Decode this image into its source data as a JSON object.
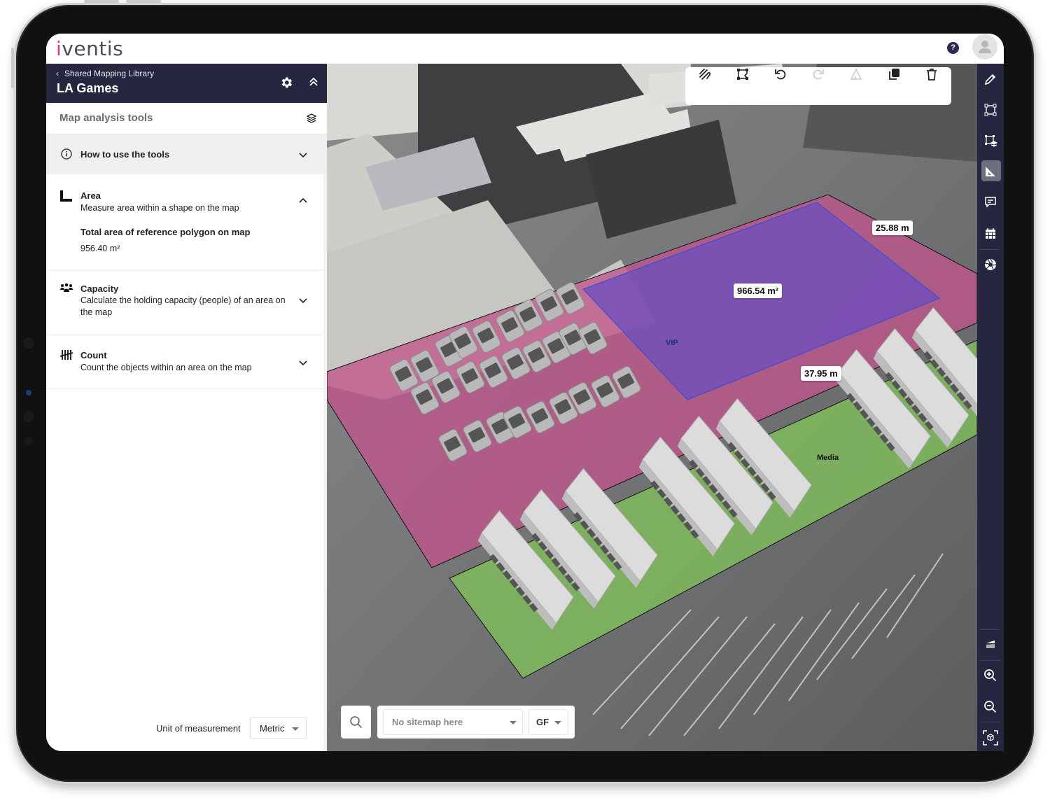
{
  "app": {
    "logo_first": "i",
    "logo_rest": "ventis",
    "help_label": "?",
    "brand_color": "#d63a8a",
    "navy": "#252740"
  },
  "panel": {
    "breadcrumb": "Shared Mapping Library",
    "project_title": "LA Games",
    "tools_title": "Map analysis tools",
    "how_to": "How to use the tools",
    "sections": [
      {
        "title": "Area",
        "description": "Measure area within a shape on the map",
        "expanded": true,
        "result_label": "Total area of reference polygon on map",
        "result_value": "956.40 m²"
      },
      {
        "title": "Capacity",
        "description": "Calculate the holding capacity (people) of an area on the map",
        "expanded": false
      },
      {
        "title": "Count",
        "description": "Count the objects within an area on the map",
        "expanded": false
      }
    ],
    "unit_label": "Unit of measurement",
    "unit_value": "Metric"
  },
  "map": {
    "measurements": {
      "area": "966.54 m²",
      "width": "25.88 m",
      "length": "37.95 m"
    },
    "zone_labels": {
      "vip": "VIP",
      "media": "Media"
    },
    "zone_colors": {
      "outer": "#c0558c",
      "vip": "#6a4dc0",
      "media": "#7fbf5a"
    },
    "toolbar": [
      {
        "name": "freehand-draw",
        "enabled": true
      },
      {
        "name": "edit-shape",
        "enabled": true
      },
      {
        "name": "undo",
        "enabled": true
      },
      {
        "name": "redo",
        "enabled": false
      },
      {
        "name": "triangle-measure",
        "enabled": false
      },
      {
        "name": "duplicate",
        "enabled": true
      },
      {
        "name": "delete",
        "enabled": true
      }
    ],
    "sitemap_placeholder": "No sitemap here",
    "floor_value": "GF"
  },
  "rail": {
    "items": [
      "pencil",
      "polygon",
      "polygon-layers",
      "measure",
      "comment",
      "calendar",
      "aperture"
    ],
    "active": "measure",
    "bottom_items": [
      "compass",
      "zoom-in",
      "zoom-out",
      "3d-view"
    ]
  }
}
